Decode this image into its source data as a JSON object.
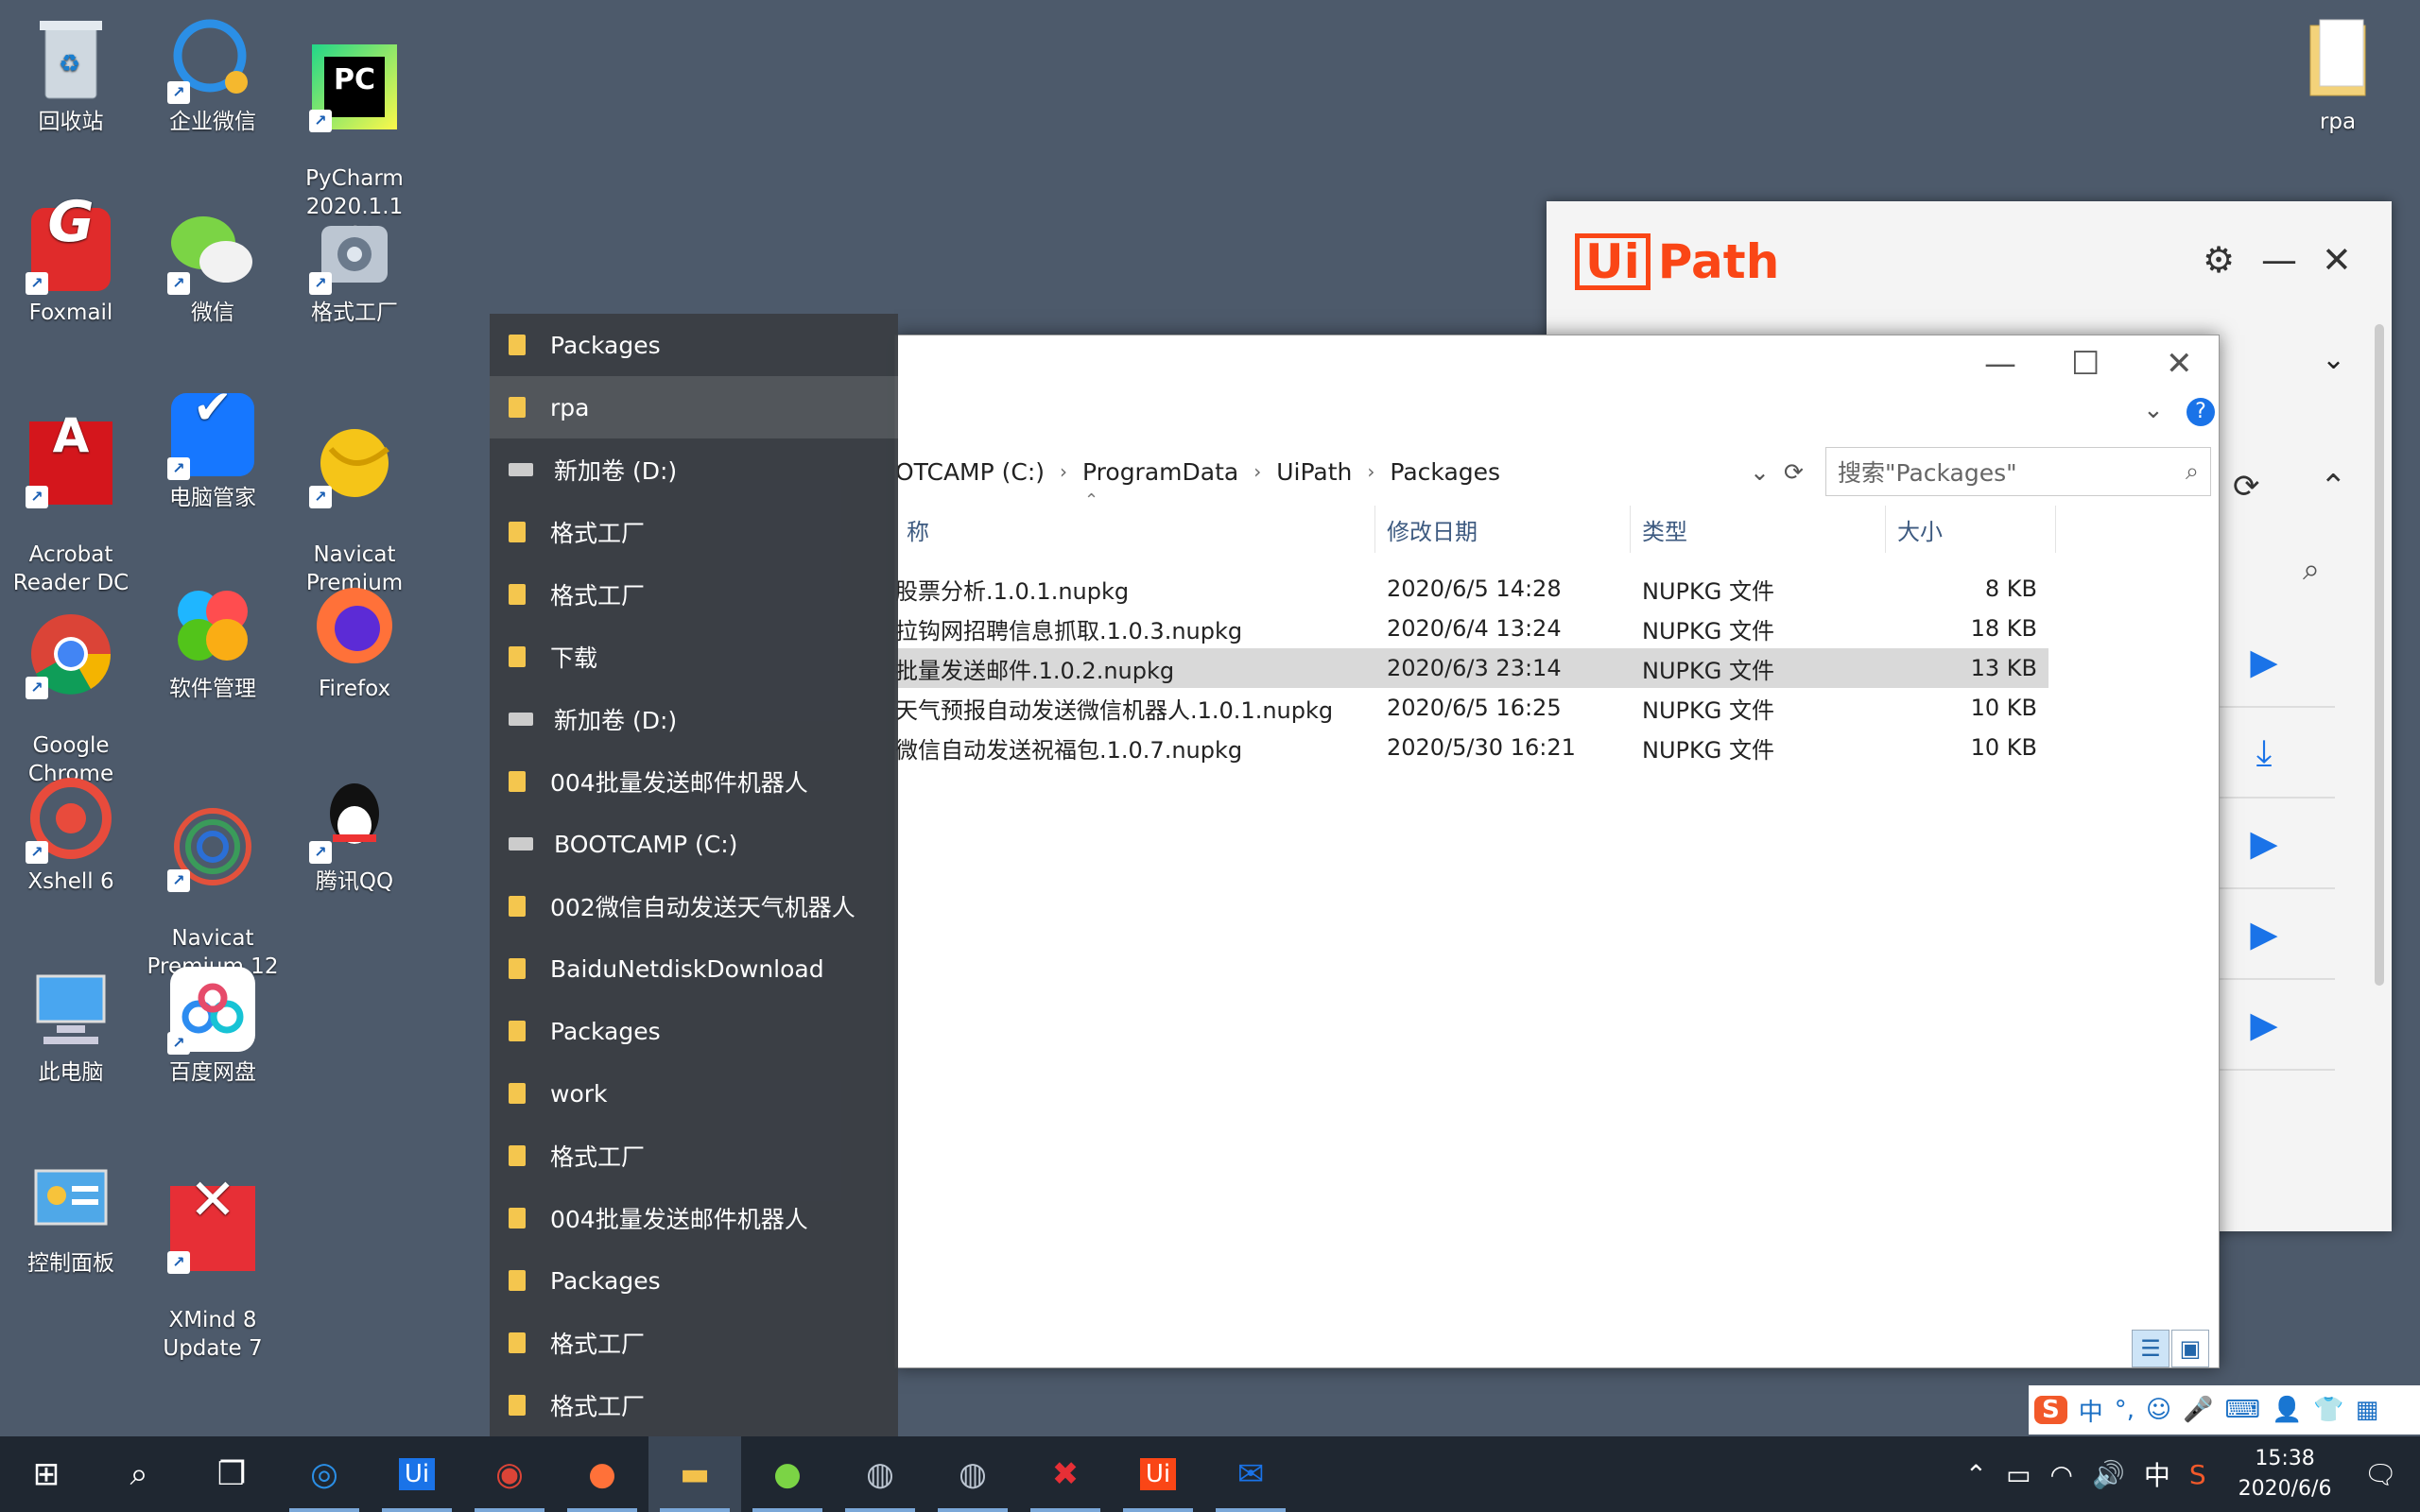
{
  "desktop_icons": {
    "recycle_bin": "回收站",
    "wecom": "企业微信",
    "pycharm": "PyCharm\n2020.1.1 x64",
    "foxmail": "Foxmail",
    "wechat": "微信",
    "format_factory": "格式工厂",
    "acrobat": "Acrobat\nReader DC",
    "pc_manager": "电脑管家",
    "navicat_premium": "Navicat\nPremium",
    "chrome": "Google\nChrome",
    "software_mgmt": "软件管理",
    "firefox": "Firefox",
    "xshell": "Xshell 6",
    "navicat12": "Navicat\nPremium 12",
    "qq": "腾讯QQ",
    "this_pc": "此电脑",
    "baidu_pan": "百度网盘",
    "control_panel": "控制面板",
    "xmind": "XMind 8\nUpdate 7",
    "rpa_folder": "rpa"
  },
  "uipath": {
    "logo_box": "Ui",
    "logo_text": "Path"
  },
  "explorer": {
    "breadcrumb": [
      "OTCAMP (C:)",
      "ProgramData",
      "UiPath",
      "Packages"
    ],
    "search_placeholder": "搜索\"Packages\"",
    "columns": {
      "name": "称",
      "date": "修改日期",
      "type": "类型",
      "size": "大小"
    },
    "files": [
      {
        "name": "股票分析.1.0.1.nupkg",
        "date": "2020/6/5 14:28",
        "type": "NUPKG 文件",
        "size": "8 KB"
      },
      {
        "name": "拉钩网招聘信息抓取.1.0.3.nupkg",
        "date": "2020/6/4 13:24",
        "type": "NUPKG 文件",
        "size": "18 KB"
      },
      {
        "name": "批量发送邮件.1.0.2.nupkg",
        "date": "2020/6/3 23:14",
        "type": "NUPKG 文件",
        "size": "13 KB"
      },
      {
        "name": "天气预报自动发送微信机器人.1.0.1.nupkg",
        "date": "2020/6/5 16:25",
        "type": "NUPKG 文件",
        "size": "10 KB"
      },
      {
        "name": "微信自动发送祝福包.1.0.7.nupkg",
        "date": "2020/5/30 16:21",
        "type": "NUPKG 文件",
        "size": "10 KB"
      }
    ],
    "selected_index": 2
  },
  "jumplist": [
    {
      "label": "Packages",
      "kind": "folder"
    },
    {
      "label": "rpa",
      "kind": "folder"
    },
    {
      "label": "新加卷 (D:)",
      "kind": "drive"
    },
    {
      "label": "格式工厂",
      "kind": "folder"
    },
    {
      "label": "格式工厂",
      "kind": "folder"
    },
    {
      "label": "下载",
      "kind": "folder"
    },
    {
      "label": "新加卷 (D:)",
      "kind": "drive"
    },
    {
      "label": "004批量发送邮件机器人",
      "kind": "folder"
    },
    {
      "label": "BOOTCAMP (C:)",
      "kind": "drive"
    },
    {
      "label": "002微信自动发送天气机器人",
      "kind": "folder"
    },
    {
      "label": "BaiduNetdiskDownload",
      "kind": "folder"
    },
    {
      "label": "Packages",
      "kind": "folder"
    },
    {
      "label": "work",
      "kind": "folder"
    },
    {
      "label": "格式工厂",
      "kind": "folder"
    },
    {
      "label": "004批量发送邮件机器人",
      "kind": "folder"
    },
    {
      "label": "Packages",
      "kind": "folder"
    },
    {
      "label": "格式工厂",
      "kind": "folder"
    },
    {
      "label": "格式工厂",
      "kind": "folder"
    }
  ],
  "taskbar": {
    "clock_time": "15:38",
    "clock_date": "2020/6/6",
    "ime_lang": "中"
  },
  "ime_bar": {
    "lang": "中"
  }
}
